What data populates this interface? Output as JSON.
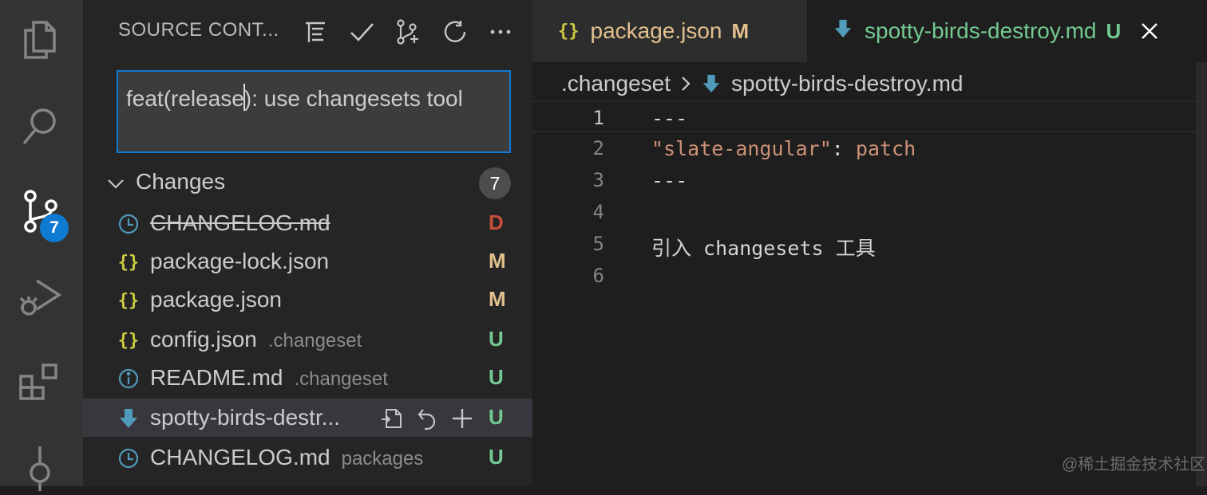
{
  "activity_bar": {
    "items": [
      {
        "name": "explorer",
        "icon": "files-icon"
      },
      {
        "name": "search",
        "icon": "search-icon"
      },
      {
        "name": "source-control",
        "icon": "source-control-icon",
        "badge": "7"
      },
      {
        "name": "run-debug",
        "icon": "run-debug-icon"
      },
      {
        "name": "extensions",
        "icon": "extensions-icon"
      },
      {
        "name": "timeline",
        "icon": "git-commit-icon"
      }
    ]
  },
  "sidebar": {
    "title": "SOURCE CONT...",
    "toolbar": [
      {
        "name": "view-as-tree",
        "icon": "list-tree-icon"
      },
      {
        "name": "commit",
        "icon": "check-icon"
      },
      {
        "name": "create-pull-request",
        "icon": "pull-request-icon"
      },
      {
        "name": "refresh",
        "icon": "refresh-icon"
      },
      {
        "name": "more-actions",
        "icon": "ellipsis-icon"
      }
    ],
    "commit_message": {
      "before_caret": "feat(release",
      "after_caret": "): use changesets tool"
    },
    "changes": {
      "label": "Changes",
      "count": "7",
      "files": [
        {
          "icon": "history-icon",
          "name": "CHANGELOG.md",
          "dir": "",
          "status": "D",
          "deleted": true
        },
        {
          "icon": "json-braces-icon",
          "name": "package-lock.json",
          "dir": "",
          "status": "M"
        },
        {
          "icon": "json-braces-icon",
          "name": "package.json",
          "dir": "",
          "status": "M"
        },
        {
          "icon": "json-braces-icon",
          "name": "config.json",
          "dir": ".changeset",
          "status": "U"
        },
        {
          "icon": "info-icon",
          "name": "README.md",
          "dir": ".changeset",
          "status": "U"
        },
        {
          "icon": "markdown-arrow-icon",
          "name": "spotty-birds-destr...",
          "dir": "",
          "status": "U",
          "selected": true
        },
        {
          "icon": "history-icon",
          "name": "CHANGELOG.md",
          "dir": "packages",
          "status": "U"
        }
      ],
      "row_actions": [
        {
          "name": "open-file",
          "icon": "go-to-file-icon"
        },
        {
          "name": "discard-changes",
          "icon": "discard-icon"
        },
        {
          "name": "stage-changes",
          "icon": "plus-icon"
        }
      ]
    }
  },
  "editor": {
    "tabs": [
      {
        "icon": "json-braces-icon",
        "label": "package.json",
        "status": "M",
        "active": false
      },
      {
        "icon": "markdown-arrow-icon",
        "label": "spotty-birds-destroy.md",
        "status": "U",
        "active": true
      }
    ],
    "breadcrumb": {
      "folder": ".changeset",
      "file": "spotty-birds-destroy.md"
    },
    "lines": [
      {
        "num": "1",
        "text": "---"
      },
      {
        "num": "2",
        "key": "\"slate-angular\"",
        "sep": ": ",
        "value": "patch"
      },
      {
        "num": "3",
        "text": "---"
      },
      {
        "num": "4",
        "text": ""
      },
      {
        "num": "5",
        "text": "引入 changesets 工具"
      },
      {
        "num": "6",
        "text": ""
      }
    ]
  },
  "watermark": "@稀土掘金技术社区",
  "colors": {
    "accent": "#0e7ad1",
    "status_deleted": "#c74e39",
    "status_modified": "#e2c08d",
    "status_untracked": "#73c991",
    "json_icon": "#cbcb41",
    "markdown_icon": "#519aba"
  }
}
